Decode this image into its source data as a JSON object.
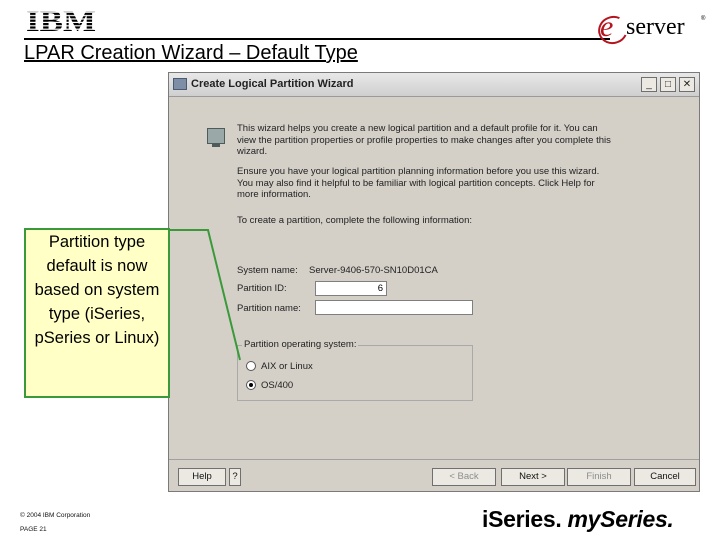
{
  "slide": {
    "logo_text": "IBM",
    "title": "LPAR Creation Wizard – Default Type",
    "eserver_e": "e",
    "eserver_word": "server",
    "eserver_tm": "®"
  },
  "dialog": {
    "title": "Create Logical Partition Wizard",
    "intro_1": "This wizard helps you create a new logical partition and a default profile for it. You can view the partition properties or profile properties to make changes after you complete this wizard.",
    "intro_2": "Ensure you have your logical partition planning information before you use this wizard. You may also find it helpful to be familiar with logical partition concepts. Click Help for more information.",
    "intro_3": "To create a partition, complete the following information:",
    "system_name_label": "System name:",
    "system_name_value": "Server-9406-570-SN10D01CA",
    "partition_id_label": "Partition ID:",
    "partition_id_value": "6",
    "partition_name_label": "Partition name:",
    "partition_name_value": "",
    "os_group_label": "Partition operating system:",
    "os_options": [
      {
        "label": "AIX or Linux",
        "selected": false
      },
      {
        "label": "OS/400",
        "selected": true
      }
    ],
    "buttons": {
      "help": "Help",
      "question": "?",
      "back": "< Back",
      "next": "Next >",
      "finish": "Finish",
      "cancel": "Cancel"
    }
  },
  "callout": {
    "text": "Partition type default is now based on system type (iSeries, pSeries or Linux)",
    "border_color": "#3a9a3a",
    "fill_color": "#ffffc6"
  },
  "footer": {
    "copyright": "© 2004 IBM Corporation",
    "page": "PAGE 21",
    "brand_1": "iSeries.",
    "brand_2": "mySeries."
  }
}
